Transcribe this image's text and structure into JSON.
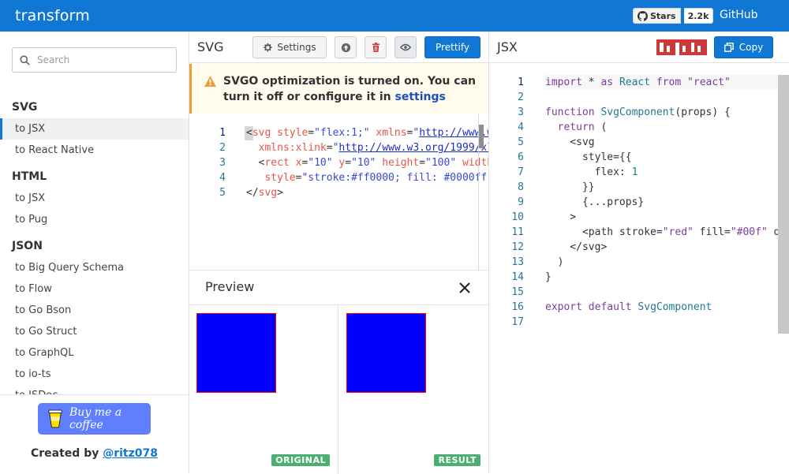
{
  "app": {
    "brand": "transform",
    "stars_label": "Stars",
    "stars_count": "2.2k",
    "github_link": "GitHub"
  },
  "search": {
    "placeholder": "Search"
  },
  "sidebar": {
    "groups": [
      {
        "title": "SVG",
        "items": [
          "to JSX",
          "to React Native"
        ]
      },
      {
        "title": "HTML",
        "items": [
          "to JSX",
          "to Pug"
        ]
      },
      {
        "title": "JSON",
        "items": [
          "to Big Query Schema",
          "to Flow",
          "to Go Bson",
          "to Go Struct",
          "to GraphQL",
          "to io-ts",
          "to JSDoc"
        ]
      }
    ],
    "active": "SVG/to JSX"
  },
  "footer": {
    "coffee_label": "Buy me a coffee",
    "created_prefix": "Created by",
    "created_handle": "@ritz078"
  },
  "input_panel": {
    "title": "SVG",
    "settings_label": "Settings",
    "prettify_label": "Prettify",
    "warning_text": "SVGO optimization is turned on. You can turn it off or configure it in",
    "warning_link": "settings",
    "line_numbers": [
      "1",
      "2",
      "3",
      "4",
      "5"
    ]
  },
  "preview": {
    "title": "Preview",
    "original_badge": "ORIGINAL",
    "result_badge": "RESULT",
    "fill_color": "#0000ff",
    "stroke_color": "#ff0000"
  },
  "output_panel": {
    "title": "JSX",
    "copy_label": "Copy",
    "line_numbers": [
      "1",
      "2",
      "3",
      "4",
      "5",
      "6",
      "7",
      "8",
      "9",
      "10",
      "11",
      "12",
      "13",
      "14",
      "15",
      "16",
      "17"
    ]
  },
  "colors": {
    "primary": "#1077d4",
    "warning_accent": "#e9a23b",
    "badge_green": "#4caf72",
    "npm_red": "#cb3837"
  }
}
